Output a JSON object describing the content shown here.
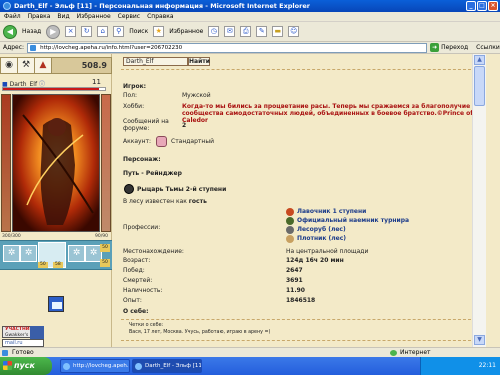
{
  "window": {
    "title": "Darth_Elf - Эльф [11] - Персональная информация - Microsoft Internet Explorer",
    "minimize": "_",
    "maximize": "□",
    "close": "×"
  },
  "menubar": [
    "Файл",
    "Правка",
    "Вид",
    "Избранное",
    "Сервис",
    "Справка"
  ],
  "toolbar": {
    "back": "Назад",
    "search": "Поиск",
    "favorites": "Избранное"
  },
  "address": {
    "label": "Адрес:",
    "url": "http://lovcheg.apeha.ru/info.html?user=206702230",
    "go": "Переход",
    "links": "Ссылки"
  },
  "left": {
    "score": "508.9",
    "char_name": "Darth_Elf",
    "level": "11",
    "hp_fraction": 0.94,
    "stats_left": "300/300",
    "stats_right": "90/90",
    "equip_vals": [
      "50",
      "58",
      "50",
      "50"
    ],
    "badge_line1": "УЧАСТНИК",
    "badge_line2": "Gwakker's",
    "badge_line3": "mail.ru"
  },
  "profile": {
    "name": "Darth_Elf",
    "status": "Найти",
    "player_heading": "Игрок:",
    "gender_label": "Пол:",
    "gender_value": "Мужской",
    "hobby_label": "Хобби:",
    "hobby_value": "Когда-то мы бились за процветание расы. Теперь мы сражаемся за благополучие сообщества самодостаточных людей, объединенных в боевое братство.©Prince of Caledor",
    "forum_label": "Сообщений на форуме:",
    "forum_value": "2",
    "account_label": "Аккаунт:",
    "account_value": "Стандартный",
    "character_heading": "Персонаж:",
    "path": "Путь - Рейнджер",
    "rank": "Рыцарь Тьмы 2-й ступени",
    "known_prefix": "В лесу известен как",
    "known_value": "гость",
    "professions_label": "Профессии:",
    "professions": [
      "Лавочник 1 ступени",
      "Официальный наемник турнира",
      "Лесоруб (лес)",
      "Плотник (лес)"
    ],
    "location_label": "Местонахождение:",
    "location_value": "На центральной площади",
    "age_label": "Возраст:",
    "age_value": "124д 16ч 20 мин",
    "wins_label": "Побед:",
    "wins_value": "2647",
    "deaths_label": "Смертей:",
    "deaths_value": "3691",
    "cash_label": "Наличность:",
    "cash_value": "11.90",
    "exp_label": "Опыт:",
    "exp_value": "1846518",
    "about_heading": "О себе:",
    "about_line1": "Четки о себе:",
    "about_line2": "Вася, 17 лет, Москва. Учусь, работаю, играю в арену =)"
  },
  "status": {
    "left": "Готово",
    "zone": "Интернет"
  },
  "taskbar": {
    "start": "пуск",
    "tasks": [
      "http://lovcheg.apeh...",
      "Darth_Elf - Эльф [11]..."
    ],
    "clock": "22:11"
  }
}
